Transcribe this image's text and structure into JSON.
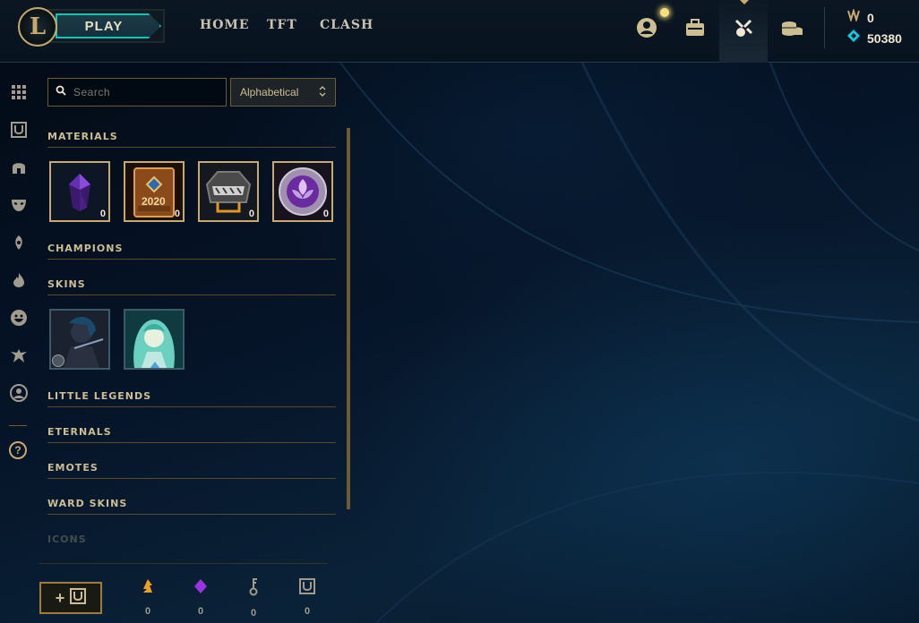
{
  "topbar": {
    "play_label": "PLAY",
    "nav": [
      "HOME",
      "TFT",
      "CLASH"
    ],
    "icons": [
      "profile-icon",
      "collection-icon",
      "loot-icon",
      "store-icon"
    ],
    "currency": {
      "orange_essence": "0",
      "blue_essence": "50380"
    }
  },
  "sidebar": {
    "items": [
      "all-icon",
      "chest-icon",
      "helmet-icon",
      "mask-icon",
      "ward-icon",
      "fire-icon",
      "emote-icon",
      "little-legend-icon",
      "profile-icon"
    ],
    "help_label": "?"
  },
  "search": {
    "placeholder": "Search"
  },
  "sort": {
    "selected": "Alphabetical"
  },
  "categories": {
    "materials": "MATERIALS",
    "champions": "CHAMPIONS",
    "skins": "SKINS",
    "little_legends": "LITTLE LEGENDS",
    "eternals": "ETERNALS",
    "emotes": "EMOTES",
    "ward_skins": "WARD SKINS",
    "icons": "ICONS"
  },
  "materials": [
    {
      "name": "gemstone-icon",
      "count": "0"
    },
    {
      "name": "event-pass-2020-icon",
      "count": "0"
    },
    {
      "name": "chest-icon",
      "count": "0"
    },
    {
      "name": "orb-icon",
      "count": "0"
    }
  ],
  "materials_labels": {
    "event_year": "2020"
  },
  "skins": [
    {
      "name": "skin-dark",
      "badge": "rune-badge"
    },
    {
      "name": "skin-spirit",
      "badge": "rarity-badge"
    }
  ],
  "bottom": {
    "resources": [
      {
        "name": "orange-essence-icon",
        "value": "0"
      },
      {
        "name": "mythic-essence-icon",
        "value": "0"
      },
      {
        "name": "key-icon",
        "value": "0"
      },
      {
        "name": "chest-resource-icon",
        "value": "0"
      }
    ]
  },
  "colors": {
    "gold": "#c8aa6e",
    "teal": "#0ac8b9",
    "orange_essence": "#f0a020",
    "mythic": "#9b34e0",
    "blue_essence": "#0acbe6"
  }
}
